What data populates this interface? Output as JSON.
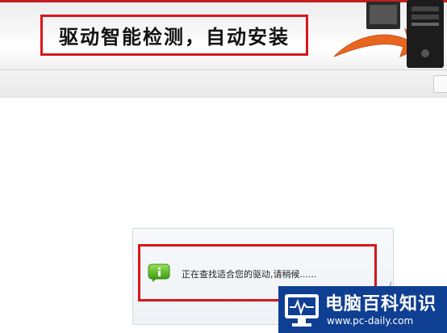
{
  "banner": {
    "headline": "驱动智能检测，自动安装",
    "colors": {
      "accent": "#d8161b",
      "arrow": "#e8661e"
    }
  },
  "status": {
    "icon": "info-icon",
    "message": "正在查找适合您的驱动,请稍候......"
  },
  "watermark": {
    "title": "电脑百科知识",
    "url": "www.pc-daily.com",
    "icon": "monitor-pulse-icon",
    "colors": {
      "background": "#0f3f93"
    }
  }
}
